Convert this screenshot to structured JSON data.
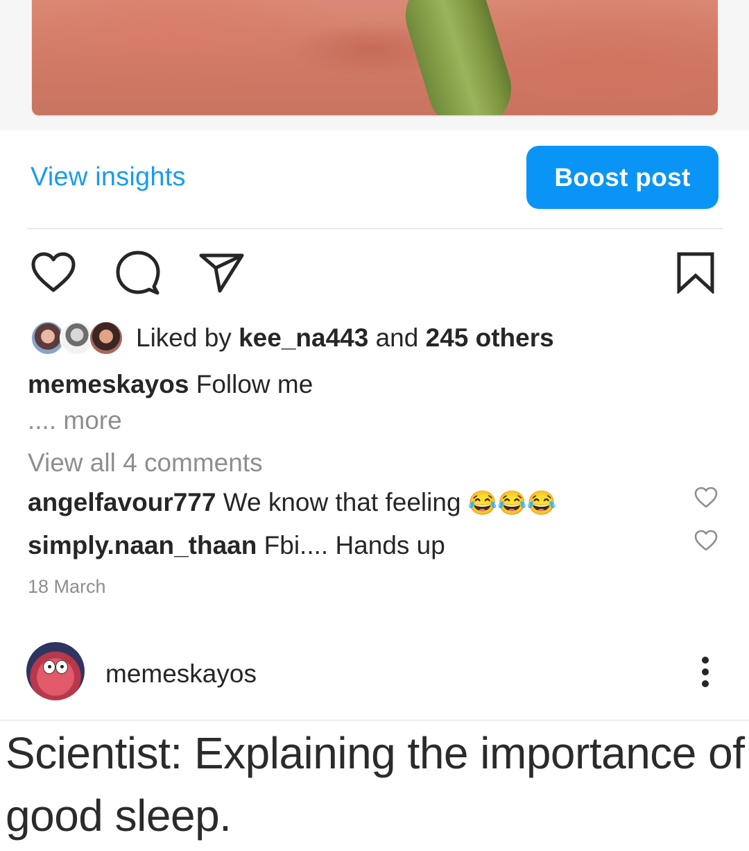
{
  "post_actions": {
    "view_insights": "View insights",
    "boost_post": "Boost post"
  },
  "icons": {
    "like": "heart-icon",
    "comment": "comment-bubble-icon",
    "share": "paper-plane-icon",
    "save": "bookmark-icon",
    "comment_like": "heart-icon",
    "more": "more-vertical-icon"
  },
  "likes": {
    "prefix": "Liked by",
    "user": "kee_na443",
    "connector": "and",
    "others": "245 others"
  },
  "caption": {
    "username": "memeskayos",
    "text": "Follow me",
    "more": ".... more"
  },
  "comments": {
    "view_all": "View all 4 comments",
    "items": [
      {
        "username": "angelfavour777",
        "text": "We know that feeling",
        "emoji": "😂😂😂"
      },
      {
        "username": "simply.naan_thaan",
        "text": "Fbi.... Hands up",
        "emoji": ""
      }
    ]
  },
  "date": "18 March",
  "next_post": {
    "username": "memeskayos",
    "meme_text": "Scientist: Explaining the importance of good sleep."
  },
  "colors": {
    "accent_blue": "#0a95f6",
    "link_blue": "#1a9bf0",
    "muted_text": "#8e8e8e",
    "text": "#262626"
  }
}
